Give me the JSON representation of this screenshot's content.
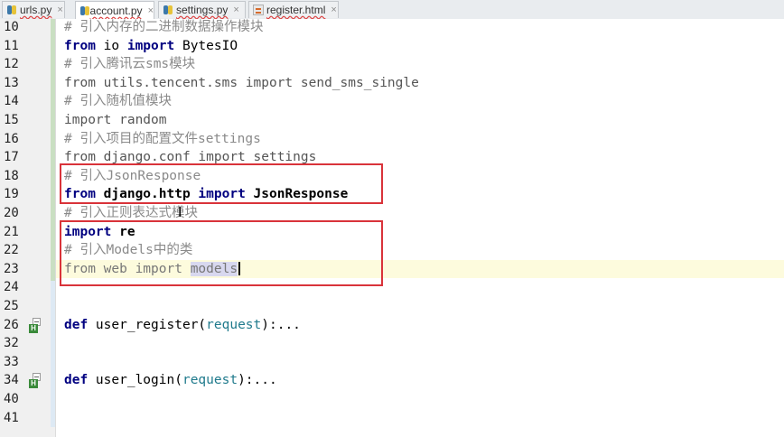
{
  "tabs": [
    {
      "label": "urls.py",
      "close": "×",
      "type": "py",
      "active": false
    },
    {
      "label": "account.py",
      "close": "×",
      "type": "py",
      "active": true
    },
    {
      "label": "settings.py",
      "close": "×",
      "type": "py",
      "active": false
    },
    {
      "label": "register.html",
      "close": "×",
      "type": "html",
      "active": false
    }
  ],
  "editor": {
    "lines": {
      "l10": {
        "num": "10",
        "text": "# 引入内存的二进制数据操作模块"
      },
      "l11": {
        "num": "11",
        "kw1": "from",
        "t1": " io ",
        "kw2": "import",
        "t2": " BytesIO"
      },
      "l12": {
        "num": "12",
        "text": "# 引入腾讯云sms模块"
      },
      "l13": {
        "num": "13",
        "text": "from utils.tencent.sms import send_sms_single"
      },
      "l14": {
        "num": "14",
        "text": "# 引入随机值模块"
      },
      "l15": {
        "num": "15",
        "text": "import random"
      },
      "l16": {
        "num": "16",
        "text": "# 引入项目的配置文件settings"
      },
      "l17": {
        "num": "17",
        "text": "from django.conf import settings"
      },
      "l18": {
        "num": "18",
        "text": "# 引入JsonResponse"
      },
      "l19": {
        "num": "19",
        "kw1": "from",
        "t1": " django.http ",
        "kw2": "import",
        "t2": " JsonResponse"
      },
      "l20": {
        "num": "20",
        "text": "# 引入正则表达式模块"
      },
      "l21": {
        "num": "21",
        "kw1": "import",
        "t1": " re"
      },
      "l22": {
        "num": "22",
        "text": "# 引入Models中的类"
      },
      "l23": {
        "num": "23",
        "t1": "from web import ",
        "t2": "models"
      },
      "l24": {
        "num": "24"
      },
      "l25": {
        "num": "25"
      },
      "l26": {
        "num": "26",
        "kw": "def",
        "fn": " user_register(",
        "param": "request",
        "rest": "):...",
        "badge": "H"
      },
      "l32": {
        "num": "32"
      },
      "l33": {
        "num": "33"
      },
      "l34": {
        "num": "34",
        "kw": "def",
        "fn": " user_login(",
        "param": "request",
        "rest": "):...",
        "badge": "H"
      },
      "l40": {
        "num": "40"
      },
      "l41": {
        "num": "41"
      }
    }
  },
  "colors": {
    "annotation_box": "#d9333a",
    "current_line": "#fdfbdd",
    "keyword": "#000080",
    "comment": "#8a8a8a",
    "parameter": "#1f7a8c"
  },
  "icons": {
    "py_tab": "python-file-icon",
    "html_tab": "html-file-icon",
    "fold": "fold-collapsed-icon",
    "caret": "text-cursor-ibeam"
  }
}
